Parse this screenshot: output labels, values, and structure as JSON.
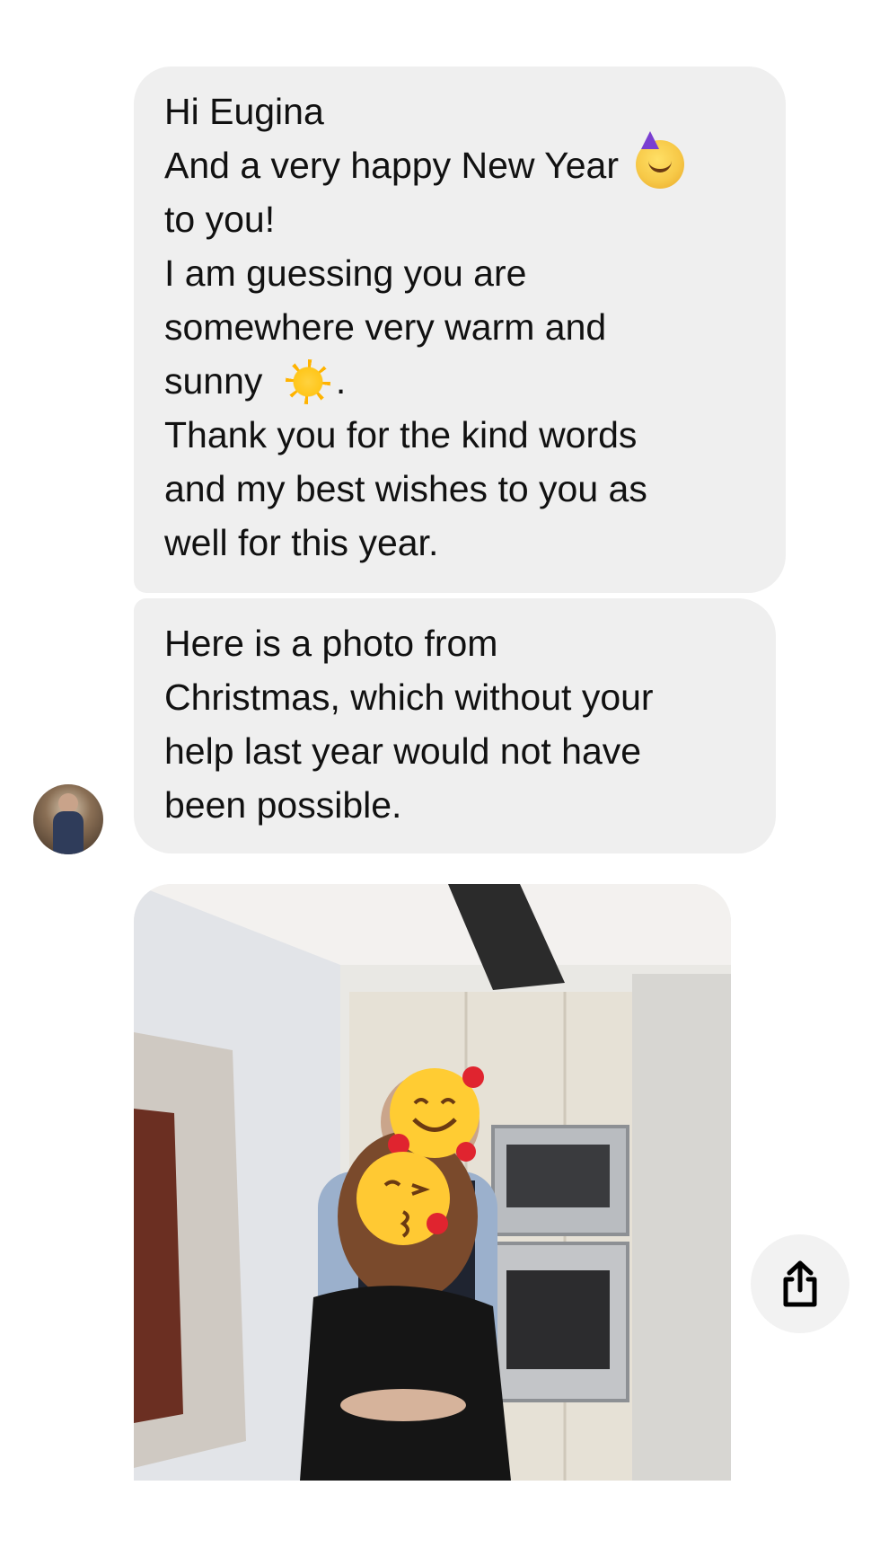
{
  "messages": [
    {
      "lines": [
        {
          "text": "Hi Eugina",
          "emoji": null,
          "suffix": ""
        },
        {
          "text": "And a very happy New Year ",
          "emoji": "partying-face-emoji",
          "suffix": ""
        },
        {
          "text": "to you!",
          "emoji": null,
          "suffix": ""
        },
        {
          "text": "I am guessing you are",
          "emoji": null,
          "suffix": ""
        },
        {
          "text": "somewhere very warm and",
          "emoji": null,
          "suffix": ""
        },
        {
          "text": "sunny ",
          "emoji": "sun-emoji",
          "suffix": "."
        },
        {
          "text": "Thank you for the kind words",
          "emoji": null,
          "suffix": ""
        },
        {
          "text": "and my best wishes to you as",
          "emoji": null,
          "suffix": ""
        },
        {
          "text": "well for this year.",
          "emoji": null,
          "suffix": ""
        }
      ]
    },
    {
      "lines": [
        {
          "text": "Here is a photo from"
        },
        {
          "text": "Christmas, which without your"
        },
        {
          "text": "help last year would not have"
        },
        {
          "text": "been possible."
        }
      ]
    }
  ],
  "attachment": {
    "type": "photo",
    "overlay_emojis": [
      "smiling-face-with-hearts-emoji",
      "face-blowing-a-kiss-emoji"
    ]
  },
  "icons": {
    "share": "share-icon",
    "avatar": "sender-avatar"
  },
  "colors": {
    "bubble": "#efefef",
    "text": "#111111",
    "share_bg": "#f2f2f2"
  }
}
